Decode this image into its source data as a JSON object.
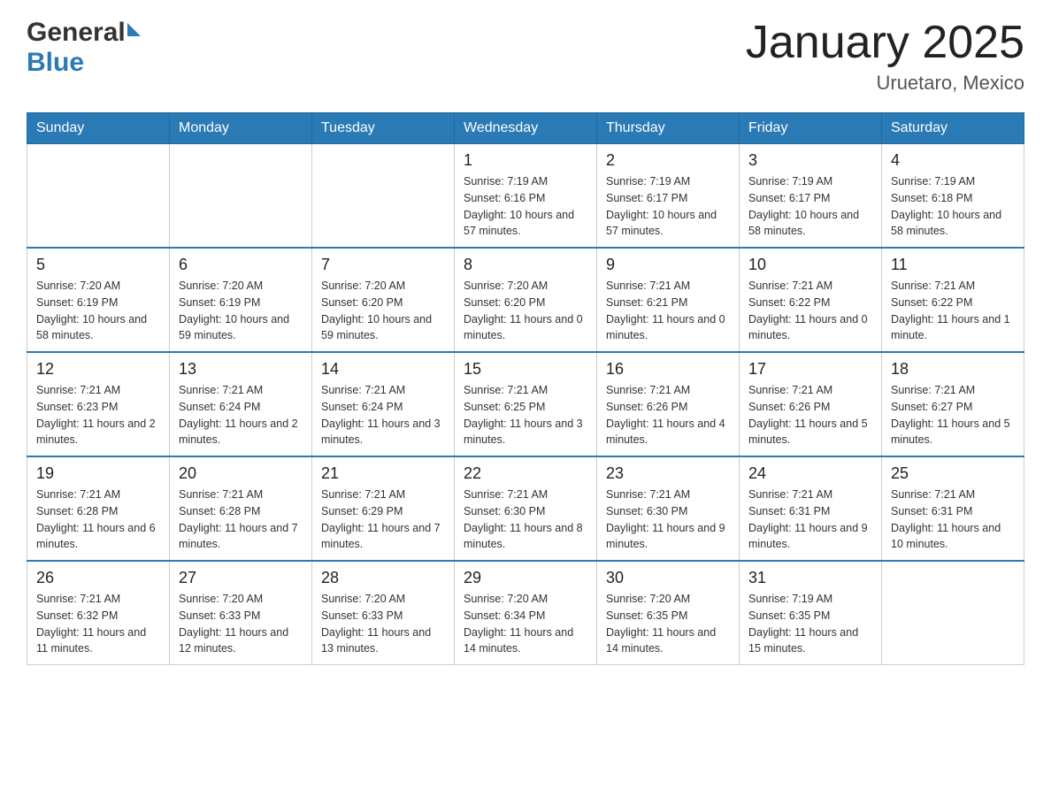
{
  "header": {
    "logo_general": "General",
    "logo_blue": "Blue",
    "title": "January 2025",
    "subtitle": "Uruetaro, Mexico"
  },
  "weekdays": [
    "Sunday",
    "Monday",
    "Tuesday",
    "Wednesday",
    "Thursday",
    "Friday",
    "Saturday"
  ],
  "weeks": [
    [
      {
        "day": "",
        "info": ""
      },
      {
        "day": "",
        "info": ""
      },
      {
        "day": "",
        "info": ""
      },
      {
        "day": "1",
        "info": "Sunrise: 7:19 AM\nSunset: 6:16 PM\nDaylight: 10 hours and 57 minutes."
      },
      {
        "day": "2",
        "info": "Sunrise: 7:19 AM\nSunset: 6:17 PM\nDaylight: 10 hours and 57 minutes."
      },
      {
        "day": "3",
        "info": "Sunrise: 7:19 AM\nSunset: 6:17 PM\nDaylight: 10 hours and 58 minutes."
      },
      {
        "day": "4",
        "info": "Sunrise: 7:19 AM\nSunset: 6:18 PM\nDaylight: 10 hours and 58 minutes."
      }
    ],
    [
      {
        "day": "5",
        "info": "Sunrise: 7:20 AM\nSunset: 6:19 PM\nDaylight: 10 hours and 58 minutes."
      },
      {
        "day": "6",
        "info": "Sunrise: 7:20 AM\nSunset: 6:19 PM\nDaylight: 10 hours and 59 minutes."
      },
      {
        "day": "7",
        "info": "Sunrise: 7:20 AM\nSunset: 6:20 PM\nDaylight: 10 hours and 59 minutes."
      },
      {
        "day": "8",
        "info": "Sunrise: 7:20 AM\nSunset: 6:20 PM\nDaylight: 11 hours and 0 minutes."
      },
      {
        "day": "9",
        "info": "Sunrise: 7:21 AM\nSunset: 6:21 PM\nDaylight: 11 hours and 0 minutes."
      },
      {
        "day": "10",
        "info": "Sunrise: 7:21 AM\nSunset: 6:22 PM\nDaylight: 11 hours and 0 minutes."
      },
      {
        "day": "11",
        "info": "Sunrise: 7:21 AM\nSunset: 6:22 PM\nDaylight: 11 hours and 1 minute."
      }
    ],
    [
      {
        "day": "12",
        "info": "Sunrise: 7:21 AM\nSunset: 6:23 PM\nDaylight: 11 hours and 2 minutes."
      },
      {
        "day": "13",
        "info": "Sunrise: 7:21 AM\nSunset: 6:24 PM\nDaylight: 11 hours and 2 minutes."
      },
      {
        "day": "14",
        "info": "Sunrise: 7:21 AM\nSunset: 6:24 PM\nDaylight: 11 hours and 3 minutes."
      },
      {
        "day": "15",
        "info": "Sunrise: 7:21 AM\nSunset: 6:25 PM\nDaylight: 11 hours and 3 minutes."
      },
      {
        "day": "16",
        "info": "Sunrise: 7:21 AM\nSunset: 6:26 PM\nDaylight: 11 hours and 4 minutes."
      },
      {
        "day": "17",
        "info": "Sunrise: 7:21 AM\nSunset: 6:26 PM\nDaylight: 11 hours and 5 minutes."
      },
      {
        "day": "18",
        "info": "Sunrise: 7:21 AM\nSunset: 6:27 PM\nDaylight: 11 hours and 5 minutes."
      }
    ],
    [
      {
        "day": "19",
        "info": "Sunrise: 7:21 AM\nSunset: 6:28 PM\nDaylight: 11 hours and 6 minutes."
      },
      {
        "day": "20",
        "info": "Sunrise: 7:21 AM\nSunset: 6:28 PM\nDaylight: 11 hours and 7 minutes."
      },
      {
        "day": "21",
        "info": "Sunrise: 7:21 AM\nSunset: 6:29 PM\nDaylight: 11 hours and 7 minutes."
      },
      {
        "day": "22",
        "info": "Sunrise: 7:21 AM\nSunset: 6:30 PM\nDaylight: 11 hours and 8 minutes."
      },
      {
        "day": "23",
        "info": "Sunrise: 7:21 AM\nSunset: 6:30 PM\nDaylight: 11 hours and 9 minutes."
      },
      {
        "day": "24",
        "info": "Sunrise: 7:21 AM\nSunset: 6:31 PM\nDaylight: 11 hours and 9 minutes."
      },
      {
        "day": "25",
        "info": "Sunrise: 7:21 AM\nSunset: 6:31 PM\nDaylight: 11 hours and 10 minutes."
      }
    ],
    [
      {
        "day": "26",
        "info": "Sunrise: 7:21 AM\nSunset: 6:32 PM\nDaylight: 11 hours and 11 minutes."
      },
      {
        "day": "27",
        "info": "Sunrise: 7:20 AM\nSunset: 6:33 PM\nDaylight: 11 hours and 12 minutes."
      },
      {
        "day": "28",
        "info": "Sunrise: 7:20 AM\nSunset: 6:33 PM\nDaylight: 11 hours and 13 minutes."
      },
      {
        "day": "29",
        "info": "Sunrise: 7:20 AM\nSunset: 6:34 PM\nDaylight: 11 hours and 14 minutes."
      },
      {
        "day": "30",
        "info": "Sunrise: 7:20 AM\nSunset: 6:35 PM\nDaylight: 11 hours and 14 minutes."
      },
      {
        "day": "31",
        "info": "Sunrise: 7:19 AM\nSunset: 6:35 PM\nDaylight: 11 hours and 15 minutes."
      },
      {
        "day": "",
        "info": ""
      }
    ]
  ]
}
